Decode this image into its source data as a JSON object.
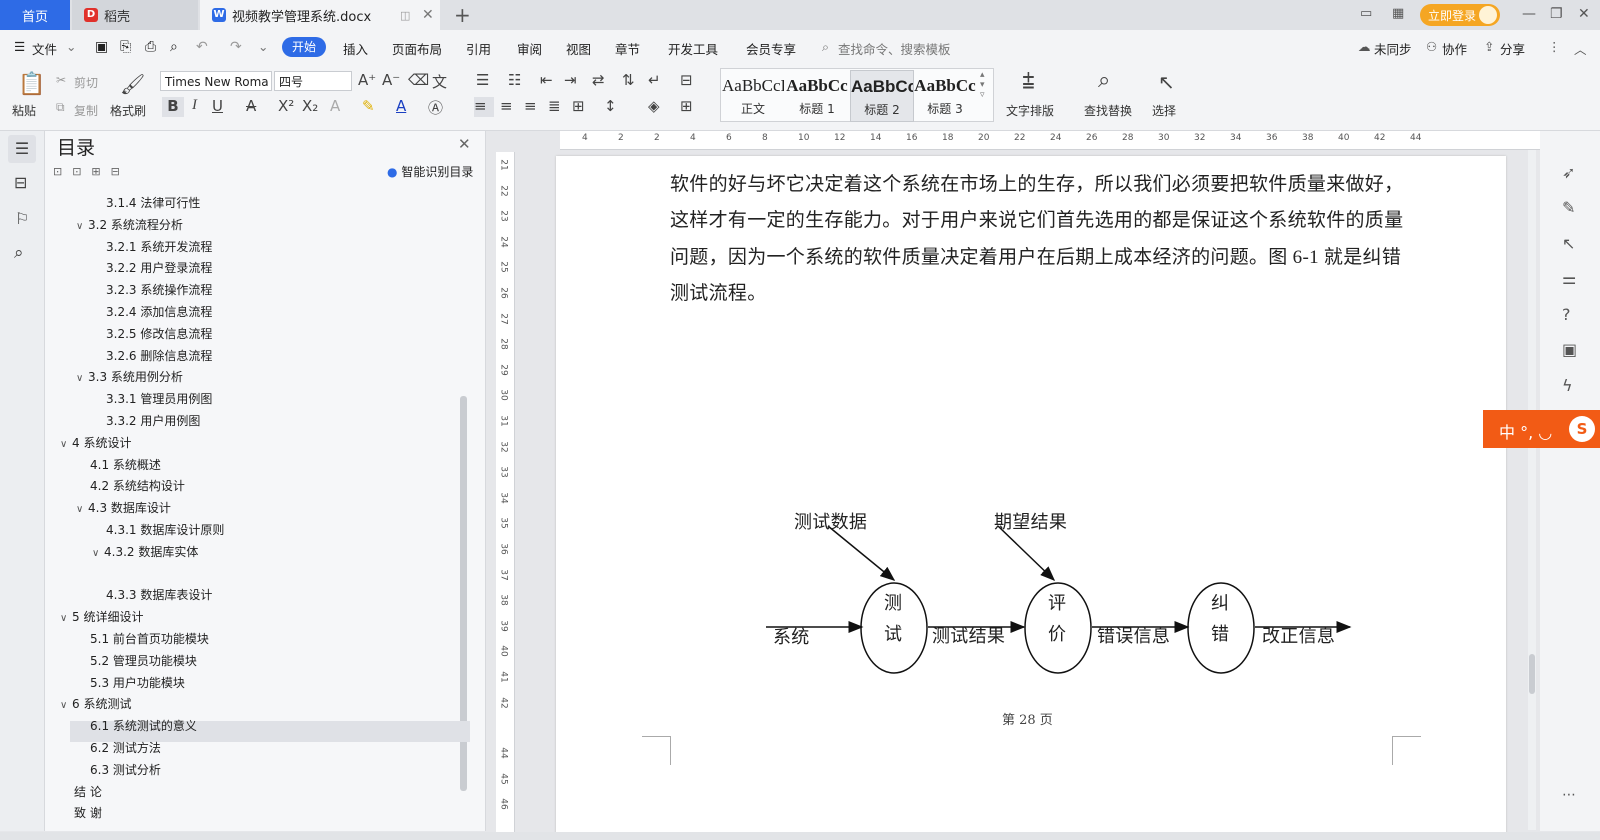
{
  "titlebar": {
    "home_tab": "首页",
    "daoke_tab": "稻壳",
    "doc_tab": "视频教学管理系统.docx",
    "login_button": "立即登录"
  },
  "menubar": {
    "file": "文件",
    "items": [
      "开始",
      "插入",
      "页面布局",
      "引用",
      "审阅",
      "视图",
      "章节",
      "开发工具",
      "会员专享"
    ],
    "search_placeholder": "查找命令、搜索模板",
    "sync": "未同步",
    "collab": "协作",
    "share": "分享"
  },
  "ribbon": {
    "paste": "粘贴",
    "cut": "剪切",
    "copy": "复制",
    "format_painter": "格式刷",
    "font_name": "Times New Roma",
    "font_size": "四号",
    "styles": [
      {
        "sample": "AaBbCcI",
        "name": "正文"
      },
      {
        "sample": "AaBbCc",
        "name": "标题 1"
      },
      {
        "sample": "AaBbCcI",
        "name": "标题 2"
      },
      {
        "sample": "AaBbCc",
        "name": "标题 3"
      }
    ],
    "text_layout": "文字排版",
    "find_replace": "查找替换",
    "select": "选择"
  },
  "toc": {
    "title": "目录",
    "smart_button": "智能识别目录",
    "items": [
      {
        "text": "3.1.4  法律可行性",
        "level": 3,
        "chev": ""
      },
      {
        "text": "3.2 系统流程分析",
        "level": 2,
        "chev": "v"
      },
      {
        "text": "3.2.1  系统开发流程",
        "level": 3,
        "chev": ""
      },
      {
        "text": "3.2.2  用户登录流程",
        "level": 3,
        "chev": ""
      },
      {
        "text": "3.2.3  系统操作流程",
        "level": 3,
        "chev": ""
      },
      {
        "text": "3.2.4  添加信息流程",
        "level": 3,
        "chev": ""
      },
      {
        "text": "3.2.5  修改信息流程",
        "level": 3,
        "chev": ""
      },
      {
        "text": "3.2.6  删除信息流程",
        "level": 3,
        "chev": ""
      },
      {
        "text": "3.3 系统用例分析",
        "level": 2,
        "chev": "v"
      },
      {
        "text": "3.3.1  管理员用例图",
        "level": 3,
        "chev": ""
      },
      {
        "text": "3.3.2 用户用例图",
        "level": 3,
        "chev": ""
      },
      {
        "text": "4  系统设计",
        "level": 1,
        "chev": "v"
      },
      {
        "text": "4.1  系统概述",
        "level": 2,
        "chev": ""
      },
      {
        "text": "4.2  系统结构设计",
        "level": 2,
        "chev": ""
      },
      {
        "text": "4.3 数据库设计",
        "level": 2,
        "chev": "v"
      },
      {
        "text": "4.3.1  数据库设计原则",
        "level": 3,
        "chev": ""
      },
      {
        "text": "4.3.2  数据库实体",
        "level": 3,
        "chev": "v"
      },
      {
        "text": "",
        "level": 3,
        "chev": ""
      },
      {
        "text": "4.3.3  数据库表设计",
        "level": 3,
        "chev": ""
      },
      {
        "text": "5 统详细设计",
        "level": 1,
        "chev": "v"
      },
      {
        "text": "5.1 前台首页功能模块",
        "level": 2,
        "chev": ""
      },
      {
        "text": "5.2 管理员功能模块",
        "level": 2,
        "chev": ""
      },
      {
        "text": "5.3 用户功能模块",
        "level": 2,
        "chev": ""
      },
      {
        "text": "6 系统测试",
        "level": 1,
        "chev": "v"
      },
      {
        "text": "6.1 系统测试的意义",
        "level": 2,
        "chev": ""
      },
      {
        "text": "6.2  测试方法",
        "level": 2,
        "chev": ""
      },
      {
        "text": "6.3 测试分析",
        "level": 2,
        "chev": ""
      },
      {
        "text": "结     论",
        "level": 1,
        "chev": ""
      },
      {
        "text": "致     谢",
        "level": 1,
        "chev": ""
      }
    ]
  },
  "document": {
    "lines": [
      "软件的好与坏它决定着这个系统在市场上的生存，所以我们必须要把软件质量来做好，",
      "这样才有一定的生存能力。对于用户来说它们首先选用的都是保证这个系统软件的质量",
      "问题，因为一个系统的软件质量决定着用户在后期上成本经济的问题。图 6-1 就是纠错",
      "测试流程。"
    ],
    "page_number": "第  28  页"
  },
  "diagram": {
    "input_label": "系统",
    "test_data_label": "测试数据",
    "expected_label": "期望结果",
    "node_test": [
      "测",
      "试"
    ],
    "node_eval": [
      "评",
      "价"
    ],
    "node_fix": [
      "纠",
      "错"
    ],
    "edge_result": "测试结果",
    "edge_error": "错误信息",
    "edge_fix": "改正信息"
  },
  "hruler_ticks": [
    "4",
    "2",
    "2",
    "4",
    "6",
    "8",
    "10",
    "12",
    "14",
    "16",
    "18",
    "20",
    "22",
    "24",
    "26",
    "28",
    "30",
    "32",
    "34",
    "36",
    "38",
    "40",
    "42",
    "44"
  ],
  "vruler_ticks": [
    "21",
    "22",
    "23",
    "24",
    "25",
    "26",
    "27",
    "28",
    "29",
    "30",
    "31",
    "32",
    "33",
    "34",
    "35",
    "36",
    "37",
    "38",
    "39",
    "40",
    "41",
    "42",
    "44",
    "45",
    "46"
  ],
  "ime": {
    "text": "中 °, ◡"
  },
  "colors": {
    "accent": "#2e6be6",
    "login": "#f5a623",
    "ime": "#f25b15"
  }
}
